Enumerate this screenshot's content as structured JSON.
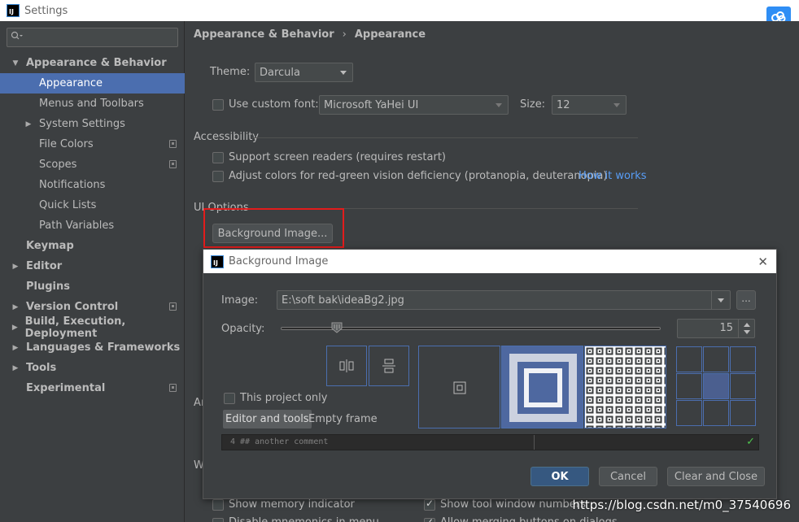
{
  "window": {
    "title": "Settings",
    "app_icon": "IJ"
  },
  "search": {
    "placeholder": ""
  },
  "sidebar": {
    "items": [
      {
        "label": "Appearance & Behavior",
        "expanded": true
      },
      {
        "label": "Appearance"
      },
      {
        "label": "Menus and Toolbars"
      },
      {
        "label": "System Settings"
      },
      {
        "label": "File Colors"
      },
      {
        "label": "Scopes"
      },
      {
        "label": "Notifications"
      },
      {
        "label": "Quick Lists"
      },
      {
        "label": "Path Variables"
      },
      {
        "label": "Keymap"
      },
      {
        "label": "Editor"
      },
      {
        "label": "Plugins"
      },
      {
        "label": "Version Control"
      },
      {
        "label": "Build, Execution, Deployment"
      },
      {
        "label": "Languages & Frameworks"
      },
      {
        "label": "Tools"
      },
      {
        "label": "Experimental"
      }
    ]
  },
  "breadcrumb": {
    "parent": "Appearance & Behavior",
    "separator": "›",
    "current": "Appearance"
  },
  "appearance": {
    "theme_label": "Theme:",
    "theme_value": "Darcula",
    "custom_font_label": "Use custom font:",
    "custom_font_value": "Microsoft YaHei UI",
    "size_label": "Size:",
    "size_value": "12"
  },
  "accessibility": {
    "title": "Accessibility",
    "screen_readers": "Support screen readers (requires restart)",
    "adjust_colors": "Adjust colors for red-green vision deficiency (protanopia, deuteranopia)",
    "how_it_works": "How it works"
  },
  "ui_options": {
    "title": "UI Options",
    "background_image_button": "Background Image...",
    "partial_label_an": "An",
    "partial_label_w": "W",
    "show_memory_indicator": "Show memory indicator",
    "show_tool_window_numbers": "Show tool window numbers",
    "partial_bottom_left": "Disable mnemonics in menu",
    "partial_bottom_right": "Allow merging buttons on dialogs"
  },
  "dialog": {
    "title": "Background Image",
    "image_label": "Image:",
    "image_path": "E:\\soft bak\\ideaBg2.jpg",
    "browse_label": "...",
    "opacity_label": "Opacity:",
    "opacity_value": "15",
    "this_project_only": "This project only",
    "editor_and_tools": "Editor and tools",
    "empty_frame": "Empty frame",
    "preview_code": "4 ## another comment",
    "ok": "OK",
    "cancel": "Cancel",
    "clear_and_close": "Clear and Close"
  },
  "watermark": "https://blog.csdn.net/m0_37540696"
}
